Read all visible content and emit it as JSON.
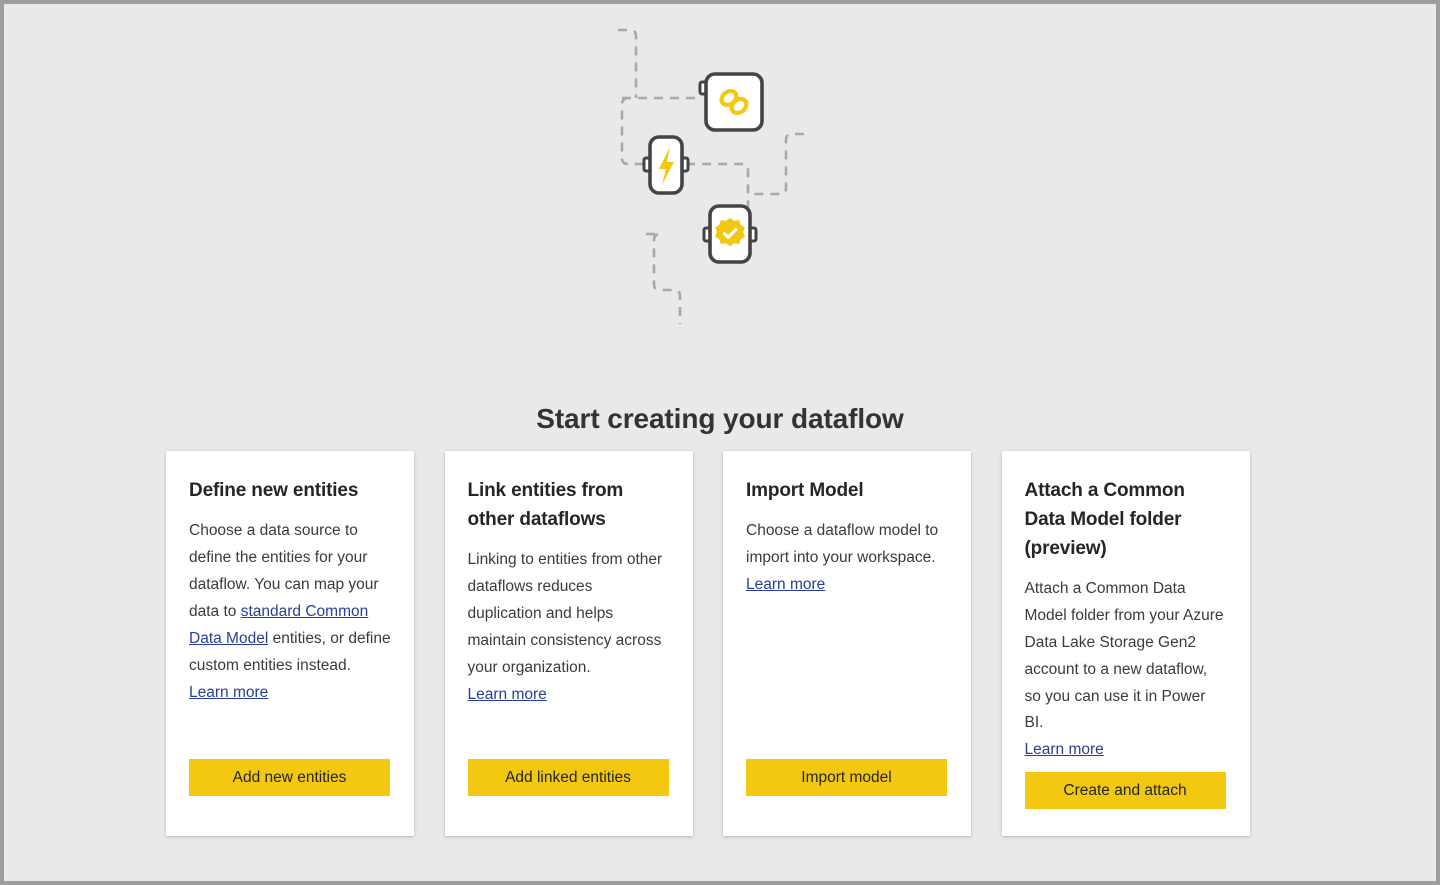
{
  "colors": {
    "page_background": "#e9e9e9",
    "frame_border": "#9d9d9d",
    "card_background": "#ffffff",
    "accent_yellow": "#f2c811",
    "link_blue": "#26409a",
    "node_outline": "#444444",
    "dashed_line": "#a8a8a8",
    "heading_text": "#333333",
    "body_text": "#3b3b3b"
  },
  "illustration": {
    "name": "dataflow-nodes-illustration",
    "nodes": [
      {
        "icon": "link-chain-icon",
        "label": "Linked entities node"
      },
      {
        "icon": "lightning-bolt-icon",
        "label": "Dataflow action node"
      },
      {
        "icon": "certified-badge-check-icon",
        "label": "Validated model node"
      }
    ]
  },
  "page_title": "Start creating your dataflow",
  "cards": [
    {
      "id": "define-new-entities",
      "title": "Define new entities",
      "body_before_link": "Choose a data source to define the entities for your dataflow. You can map your data to ",
      "inline_link": "standard Common Data Model",
      "body_after_link": " entities, or define custom entities instead.",
      "learn_more": "Learn more",
      "button": "Add new entities"
    },
    {
      "id": "link-entities-from-other-dataflows",
      "title": "Link entities from other dataflows",
      "body_before_link": "Linking to entities from other dataflows reduces duplication and helps maintain consistency across your organization.",
      "inline_link": "",
      "body_after_link": "",
      "learn_more": "Learn more",
      "button": "Add linked entities"
    },
    {
      "id": "import-model",
      "title": "Import Model",
      "body_before_link": "Choose a dataflow model to import into your workspace.",
      "inline_link": "",
      "body_after_link": "",
      "learn_more": "Learn more",
      "button": "Import model"
    },
    {
      "id": "attach-a-common-data-model-folder",
      "title": "Attach a Common Data Model folder (preview)",
      "body_before_link": "Attach a Common Data Model folder from your Azure Data Lake Storage Gen2 account to a new dataflow, so you can use it in Power BI.",
      "inline_link": "",
      "body_after_link": "",
      "learn_more": "Learn more",
      "button": "Create and attach"
    }
  ]
}
